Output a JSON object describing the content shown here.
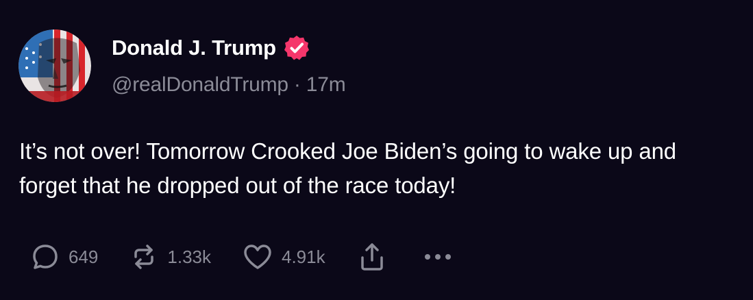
{
  "author": {
    "display_name": "Donald J. Trump",
    "handle": "@realDonaldTrump",
    "separator": "·",
    "timestamp": "17m",
    "verified_icon": "verified-badge-icon",
    "verified_color": "#f5366b"
  },
  "post": {
    "text": "It’s not over! Tomorrow Crooked Joe Biden’s going to wake up and forget that he dropped out of the race today!"
  },
  "actions": {
    "reply_icon": "reply-bubble-icon",
    "reply_count": "649",
    "repost_icon": "repost-arrows-icon",
    "repost_count": "1.33k",
    "like_icon": "heart-icon",
    "like_count": "4.91k",
    "share_icon": "share-upload-icon",
    "more_icon": "ellipsis-icon"
  },
  "colors": {
    "background": "#0b0818",
    "text_primary": "#ffffff",
    "text_secondary": "#8b8b97"
  }
}
